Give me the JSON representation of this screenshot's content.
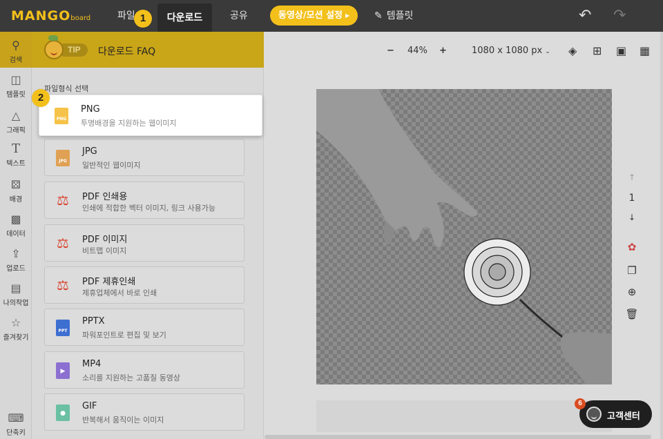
{
  "topbar": {
    "logo_main": "MANGO",
    "logo_sub": "board",
    "menu_file": "파일",
    "menu_download": "다운로드",
    "menu_share": "공유",
    "motion_button": "동영상/모션 설정",
    "template_link": "템플릿"
  },
  "steps": {
    "one": "1",
    "two": "2"
  },
  "rail": [
    {
      "label": "검색",
      "icon": "search-icon"
    },
    {
      "label": "템플릿",
      "icon": "template-icon"
    },
    {
      "label": "그래픽",
      "icon": "graphic-icon"
    },
    {
      "label": "텍스트",
      "icon": "text-icon"
    },
    {
      "label": "배경",
      "icon": "background-icon"
    },
    {
      "label": "데이터",
      "icon": "chart-icon"
    },
    {
      "label": "업로드",
      "icon": "upload-icon"
    },
    {
      "label": "나의작업",
      "icon": "printer-icon"
    },
    {
      "label": "즐겨찾기",
      "icon": "star-icon"
    },
    {
      "label": "단축키",
      "icon": "keyboard-icon"
    }
  ],
  "panel": {
    "tip_badge": "TIP",
    "tip_text": "다운로드 FAQ",
    "section_label": "파일형식 선택",
    "formats": [
      {
        "name": "PNG",
        "desc": "투명배경을 지원하는 웹이미지",
        "icon_text": "PNG",
        "color": "#f6c34a"
      },
      {
        "name": "JPG",
        "desc": "일반적인 웹이미지",
        "icon_text": "JPG",
        "color": "#e0a154"
      },
      {
        "name": "PDF 인쇄용",
        "desc": "인쇄에 적합한 벡터 이미지, 링크 사용가능",
        "icon_text": "",
        "color": "#d9432f"
      },
      {
        "name": "PDF 이미지",
        "desc": "비트맵 이미지",
        "icon_text": "",
        "color": "#d9432f"
      },
      {
        "name": "PDF 제휴인쇄",
        "desc": "제휴업체에서 바로 인쇄",
        "icon_text": "",
        "color": "#d9432f"
      },
      {
        "name": "PPTX",
        "desc": "파워포인트로 편집 및 보기",
        "icon_text": "PPT",
        "color": "#3d6fd1"
      },
      {
        "name": "MP4",
        "desc": "소리를 지원하는 고품질 동영상",
        "icon_text": "",
        "color": "#8b70d1"
      },
      {
        "name": "GIF",
        "desc": "반복해서 움직이는 이미지",
        "icon_text": "",
        "color": "#6bc0a4"
      }
    ]
  },
  "toolbar": {
    "zoom_minus": "−",
    "zoom_value": "44%",
    "zoom_plus": "+",
    "canvas_size": "1080 x 1080 px"
  },
  "pager": {
    "up": "↑",
    "page": "1",
    "down": "↓"
  },
  "help": {
    "label": "고객센터",
    "badge": "6"
  },
  "colors": {
    "accent": "#f3c01b",
    "topbar": "#3a3a3a"
  }
}
